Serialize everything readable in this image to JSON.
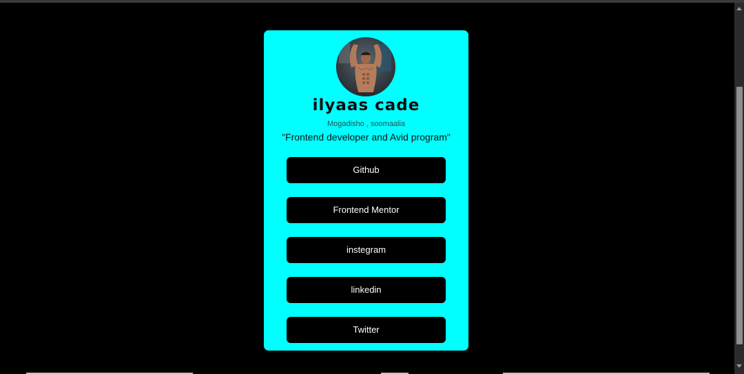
{
  "profile": {
    "name": "ilyaas cade",
    "location": "Mogadisho , soomaalia",
    "bio": "\"Frontend developer and Avid program\""
  },
  "links": [
    {
      "label": "Github"
    },
    {
      "label": "Frontend Mentor"
    },
    {
      "label": "instegram"
    },
    {
      "label": "linkedin"
    },
    {
      "label": "Twitter"
    }
  ],
  "colors": {
    "page_background": "#000000",
    "card_background": "#00ffff",
    "button_background": "#000000",
    "button_text": "#ffffff"
  },
  "icons": {
    "avatar": "profile-photo"
  }
}
